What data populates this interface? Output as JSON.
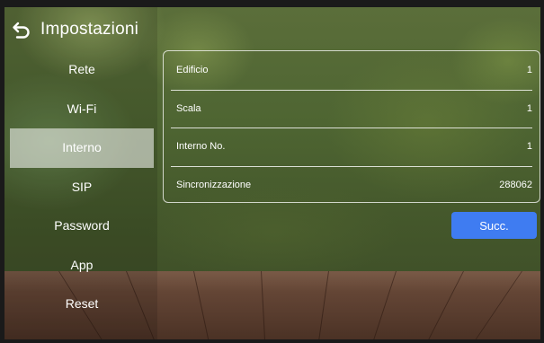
{
  "header": {
    "title": "Impostazioni",
    "back_icon": "back-arrow-icon"
  },
  "menu": {
    "items": [
      {
        "label": "Rete",
        "active": false
      },
      {
        "label": "Wi-Fi",
        "active": false
      },
      {
        "label": "Interno",
        "active": true
      },
      {
        "label": "SIP",
        "active": false
      },
      {
        "label": "Password",
        "active": false
      },
      {
        "label": "App",
        "active": false
      },
      {
        "label": "Reset",
        "active": false
      }
    ]
  },
  "settings": {
    "rows": [
      {
        "label": "Edificio",
        "value": "1"
      },
      {
        "label": "Scala",
        "value": "1"
      },
      {
        "label": "Interno No.",
        "value": "1"
      },
      {
        "label": "Sincronizzazione",
        "value": "288062"
      }
    ]
  },
  "actions": {
    "next_label": "Succ."
  },
  "colors": {
    "accent": "#3f7cf1",
    "active_item_bg": "#ffffff8c"
  }
}
